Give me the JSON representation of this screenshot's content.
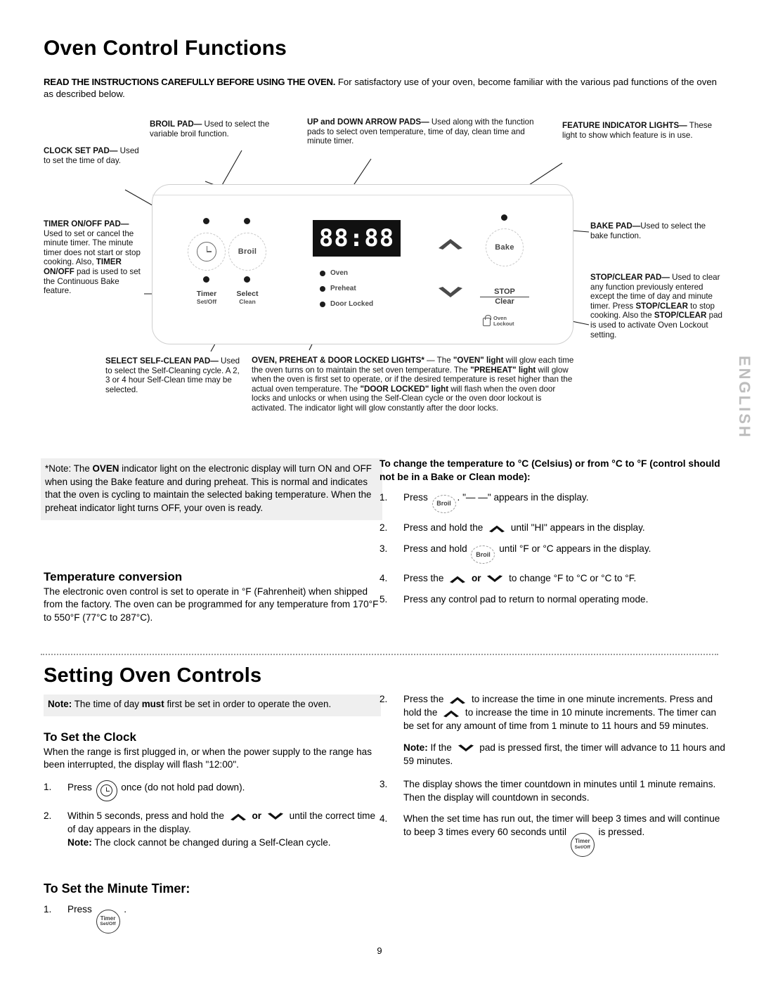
{
  "page": {
    "number": "9",
    "side_tab": "ENGLISH"
  },
  "section1": {
    "title": "Oven Control Functions",
    "intro_bold": "READ THE INSTRUCTIONS CAREFULLY BEFORE USING THE OVEN.",
    "intro_rest": " For satisfactory use of your oven, become familiar with the various pad functions of the oven as described below."
  },
  "callouts": {
    "clock_set": {
      "label": "CLOCK SET PAD—",
      "text": " Used to set the time of day."
    },
    "broil": {
      "label": "BROIL PAD—",
      "text": " Used to select the variable broil function."
    },
    "arrows": {
      "label": "UP and DOWN ARROW PADS—",
      "text": " Used along with the function pads to select oven temperature, time of day, clean time and minute timer."
    },
    "feature_lights": {
      "label": "FEATURE INDICATOR LIGHTS—",
      "text": " These light to show which feature is in use."
    },
    "timer_onoff": {
      "label": "TIMER ON/OFF PAD—",
      "text": " Used to set or cancel the minute timer. The minute timer does not start or stop cooking. Also, ",
      "label2": "TIMER ON/OFF",
      "text2": " pad is used to set the Continuous Bake feature."
    },
    "bake": {
      "label": "BAKE PAD—",
      "text": "Used to select the bake function."
    },
    "stop_clear": {
      "label": "STOP/CLEAR PAD—",
      "text": " Used to clear any function previously entered except the time of day and minute timer. Press ",
      "label2": "STOP/CLEAR",
      "text2": " to stop cooking. Also the ",
      "label3": "STOP/CLEAR",
      "text3": " pad is used to activate Oven Lockout setting."
    },
    "select_selfclean": {
      "label": "SELECT SELF-CLEAN PAD—",
      "text": " Used to select the Self-Cleaning cycle. A 2, 3 or 4 hour Self-Clean time may be selected."
    },
    "lights": {
      "label": "OVEN, PREHEAT & DOOR LOCKED LIGHTS*",
      "dash": " — The ",
      "b1": "\"OVEN\" light",
      "t1": " will glow each time the oven turns on to maintain the set oven temperature. The ",
      "b2": "\"PREHEAT\" light",
      "t2": " will glow when the oven is first set to operate, or if the desired temperature is reset higher than the actual oven temperature. The ",
      "b3": "\"DOOR LOCKED\" light",
      "t3": " will flash when the oven door locks and unlocks or when using the Self-Clean cycle or the oven door lockout is activated. The indicator light will glow constantly after the door locks."
    }
  },
  "control_panel": {
    "display_value": "88:88",
    "indicators": [
      "Oven",
      "Preheat",
      "Door Locked"
    ],
    "pads": {
      "clock_icon": "clock-icon",
      "broil_label": "Broil",
      "bake_label": "Bake",
      "timer_caption": "Timer",
      "timer_caption_sub": "Set/Off",
      "select_caption": "Select",
      "select_caption_sub": "Clean",
      "stop_label": "STOP",
      "clear_label": "Clear",
      "lockout_line1": "Oven",
      "lockout_line2": "Lockout"
    }
  },
  "note_oven_indicator": {
    "prefix": "*Note: The ",
    "bold": "OVEN",
    "rest": " indicator light on the electronic display will turn ON and OFF when using the Bake feature and during preheat. This is normal and indicates that the oven is cycling to maintain the selected baking temperature. When the preheat indicator light turns OFF, your oven is ready."
  },
  "temperature_conversion": {
    "heading": "Temperature conversion",
    "body": "The electronic oven control is set to operate in °F (Fahrenheit) when shipped from the factory. The oven can be programmed for any temperature from 170°F to 550°F (77°C to 287°C)."
  },
  "to_change_temp": {
    "lead": "To change the temperature to °C (Celsius) or from °C to °F (control should not be in a Bake or Clean mode):",
    "steps": [
      {
        "num": "1.",
        "pre": "Press ",
        "pad": "Broil",
        "post": ". \"— —\" appears in the display."
      },
      {
        "num": "2.",
        "pre": "Press and hold the ",
        "icon": "up-chevron",
        "post": " until \"HI\" appears in the display."
      },
      {
        "num": "3.",
        "pre": "Press and hold ",
        "pad": "Broil",
        "post": " until °F or °C appears in the display."
      },
      {
        "num": "4.",
        "pre": "Press the ",
        "icon": "up-chevron",
        "mid": " or ",
        "icon2": "down-chevron",
        "post": " to change °F to °C or °C to °F."
      },
      {
        "num": "5.",
        "pre": "Press any control pad to return to normal operating mode.",
        "post": ""
      }
    ]
  },
  "section2": {
    "title": "Setting Oven Controls",
    "note": {
      "bold": "Note:",
      "pre": " The time of day ",
      "bold2": "must",
      "rest": " first be set in order to operate the oven."
    }
  },
  "to_set_clock": {
    "heading": "To Set the Clock",
    "body": "When the range is first plugged in, or when the power supply to the range has been interrupted, the display will flash \"12:00\".",
    "steps": [
      {
        "num": "1.",
        "pre": "Press ",
        "icon": "clock-pad",
        "post": " once (do not hold pad down)."
      },
      {
        "num": "2.",
        "pre": "Within 5 seconds, press and hold the ",
        "icon": "up-chevron",
        "mid": " or ",
        "icon2": "down-chevron",
        "post": " until the correct time of day appears in the display.",
        "note_bold": "Note:",
        "note_rest": " The clock cannot be changed during a Self-Clean cycle."
      }
    ]
  },
  "to_set_minute_timer": {
    "heading": "To Set the Minute Timer:",
    "step1": {
      "num": "1.",
      "pre": "Press ",
      "pad_line1": "Timer",
      "pad_line2": "Set/Off",
      "post": " ."
    },
    "step2": {
      "num": "2.",
      "pre": "Press the ",
      "icon": "up-chevron",
      "mid": " to increase the time in one minute increments. Press and hold the ",
      "icon2": "up-chevron",
      "post": " to increase the time in 10 minute increments. The timer can be set for any amount of time from 1 minute to 11 hours and 59 minutes.",
      "note_bold": "Note:",
      "note_pre": " If the ",
      "note_icon": "down-chevron",
      "note_rest": " pad is pressed first, the timer will advance to 11 hours and 59 minutes."
    },
    "step3": {
      "num": "3.",
      "text": "The display shows the timer countdown in minutes until 1 minute remains. Then the display will countdown in seconds."
    },
    "step4": {
      "num": "4.",
      "pre": "When the set time has run out, the timer will beep 3 times and will continue to beep 3 times every 60 seconds until ",
      "pad_line1": "Timer",
      "pad_line2": "Set/Off",
      "post": " is pressed."
    }
  }
}
